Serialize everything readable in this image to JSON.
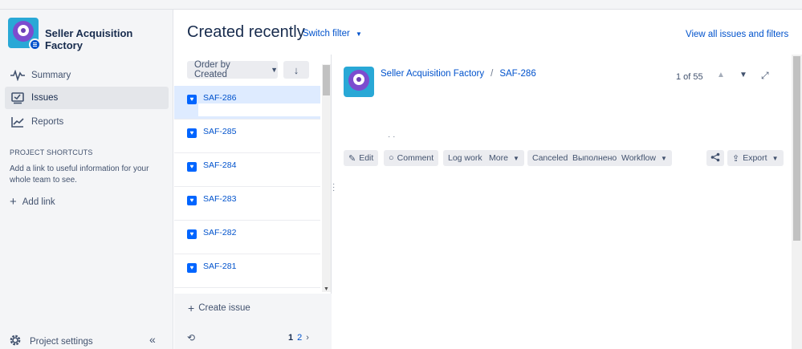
{
  "project": {
    "name": "Seller Acquisition Factory"
  },
  "sidebar": {
    "items": [
      {
        "label": "Summary",
        "icon": "pulse-icon",
        "active": false
      },
      {
        "label": "Issues",
        "icon": "issues-icon",
        "active": true
      },
      {
        "label": "Reports",
        "icon": "chart-line-icon",
        "active": false
      }
    ],
    "shortcuts_title": "PROJECT SHORTCUTS",
    "shortcuts_desc": "Add a link to useful information for your whole team to see.",
    "add_link": "Add link",
    "project_settings": "Project settings"
  },
  "header": {
    "title": "Created recently",
    "switch_filter": "Switch filter",
    "view_all": "View all issues and filters"
  },
  "list": {
    "order_label": "Order by Created",
    "issues": [
      {
        "key": "SAF-286",
        "selected": true
      },
      {
        "key": "SAF-285",
        "selected": false
      },
      {
        "key": "SAF-284",
        "selected": false
      },
      {
        "key": "SAF-283",
        "selected": false
      },
      {
        "key": "SAF-282",
        "selected": false
      },
      {
        "key": "SAF-281",
        "selected": false
      }
    ],
    "create_issue": "Create issue",
    "pages": {
      "current": "1",
      "other": "2"
    }
  },
  "detail": {
    "breadcrumb_project": "Seller Acquisition Factory",
    "breadcrumb_issue": "SAF-286",
    "counter": "1 of 55",
    "actions": {
      "edit": "Edit",
      "comment": "Comment",
      "log_work": "Log work",
      "more": "More",
      "canceled": "Canceled",
      "done_ru": "Выполнено",
      "workflow": "Workflow",
      "export": "Export"
    }
  },
  "colors": {
    "accent": "#0052cc",
    "sidebar_bg": "#f4f5f7",
    "selected_row": "#deebff",
    "avatar_bg": "#29a8d6",
    "monster": "#7c4ccf"
  }
}
